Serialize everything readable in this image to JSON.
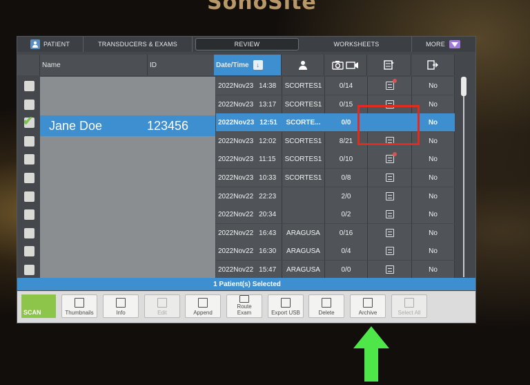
{
  "brand": "SonoSite",
  "tabs": [
    {
      "label": "PATIENT",
      "icon": "person-icon"
    },
    {
      "label": "TRANSDUCERS & EXAMS"
    },
    {
      "label": "REVIEW",
      "active": true
    },
    {
      "label": "WORKSHEETS"
    },
    {
      "label": "MORE",
      "icon": "triangle-down-icon"
    }
  ],
  "columns": {
    "name": "Name",
    "id": "ID",
    "date_time": "Date/Time",
    "user_icon": "person-icon",
    "images_icon": "camera-video-icon",
    "archive_icon": "archive-icon",
    "export_icon": "export-icon"
  },
  "selected_patient": {
    "name": "Jane Doe",
    "id": "123456"
  },
  "rows": [
    {
      "date": "2022Nov23",
      "time": "14:38",
      "user": "SCORTES1",
      "images": "0/14",
      "archived_alert": true,
      "exported": "No",
      "checked": false
    },
    {
      "date": "2022Nov23",
      "time": "13:17",
      "user": "SCORTES1",
      "images": "0/15",
      "archived_alert": false,
      "exported": "No",
      "checked": false
    },
    {
      "date": "2022Nov23",
      "time": "12:51",
      "user": "SCORTE...",
      "images": "0/0",
      "archived_alert": false,
      "exported": "No",
      "checked": true,
      "selected": true
    },
    {
      "date": "2022Nov23",
      "time": "12:02",
      "user": "SCORTES1",
      "images": "8/21",
      "archived_alert": false,
      "exported": "No",
      "checked": false
    },
    {
      "date": "2022Nov23",
      "time": "11:15",
      "user": "SCORTES1",
      "images": "0/10",
      "archived_alert": true,
      "exported": "No",
      "checked": false
    },
    {
      "date": "2022Nov23",
      "time": "10:33",
      "user": "SCORTES1",
      "images": "0/8",
      "archived_alert": false,
      "exported": "No",
      "checked": false
    },
    {
      "date": "2022Nov22",
      "time": "22:23",
      "user": "",
      "images": "2/0",
      "archived_alert": false,
      "exported": "No",
      "checked": false
    },
    {
      "date": "2022Nov22",
      "time": "20:34",
      "user": "",
      "images": "0/2",
      "archived_alert": false,
      "exported": "No",
      "checked": false
    },
    {
      "date": "2022Nov22",
      "time": "16:43",
      "user": "ARAGUSA",
      "images": "0/16",
      "archived_alert": false,
      "exported": "No",
      "checked": false
    },
    {
      "date": "2022Nov22",
      "time": "16:30",
      "user": "ARAGUSA",
      "images": "0/4",
      "archived_alert": false,
      "exported": "No",
      "checked": false
    },
    {
      "date": "2022Nov22",
      "time": "15:47",
      "user": "ARAGUSA",
      "images": "0/0",
      "archived_alert": false,
      "exported": "No",
      "checked": false
    }
  ],
  "status_text": "1  Patient(s) Selected",
  "toolbar": {
    "scan": "SCAN",
    "buttons": [
      {
        "label": "Thumbnails",
        "icon": "grid-icon",
        "enabled": true
      },
      {
        "label": "Info",
        "icon": "info-icon",
        "enabled": true
      },
      {
        "label": "Edit",
        "icon": "edit-icon",
        "enabled": false
      },
      {
        "label": "Append",
        "icon": "append-icon",
        "enabled": true
      },
      {
        "label": "Route\nExam",
        "icon": "route-icon",
        "enabled": true
      },
      {
        "label": "Export USB",
        "icon": "usb-icon",
        "enabled": true
      },
      {
        "label": "Delete",
        "icon": "trash-icon",
        "enabled": true
      },
      {
        "label": "Archive",
        "icon": "archive-icon",
        "enabled": true
      },
      {
        "label": "Select All",
        "icon": "select-all-icon",
        "enabled": false
      }
    ]
  },
  "colors": {
    "accent": "#3e8fd0",
    "scan": "#8dc44a",
    "annotation_red": "#e12b21",
    "annotation_green": "#4fe64a"
  }
}
